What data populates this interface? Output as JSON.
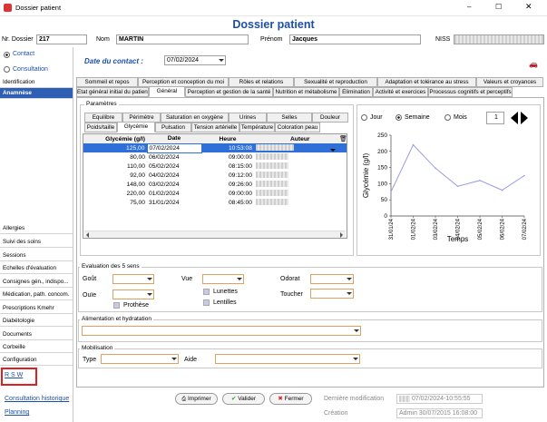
{
  "window": {
    "title": "Dossier patient"
  },
  "header": {
    "title": "Dossier patient",
    "nr_label": "Nr. Dossier",
    "nr_value": "217",
    "nom_label": "Nom",
    "nom_value": "MARTIN",
    "prenom_label": "Prénom",
    "prenom_value": "Jacques",
    "niss_label": "NISS"
  },
  "left": {
    "contact": "Contact",
    "consultation": "Consultation",
    "top_items": [
      "Identification",
      "Anamnèse"
    ],
    "items": [
      "Allergies",
      "Suivi des soins",
      "Sessions",
      "Echelles d'évaluation",
      "Consignes gén., indispo...",
      "Médication, path. concom.",
      "Prescriptions Kmehr",
      "Diabétologie",
      "Documents",
      "Corbeille",
      "Configuration"
    ],
    "rsw": "R S W",
    "consult_hist": "Consultation historique",
    "planning": "Planning"
  },
  "contact": {
    "date_label": "Date du contact :",
    "date_value": "07/02/2024"
  },
  "tabs": {
    "row1": [
      "Sommeil et repos",
      "Perception et conception du moi",
      "Rôles et relations",
      "Sexualité et reproduction",
      "Adaptation et tolérance au stress",
      "Valeurs et croyances"
    ],
    "row2": [
      "Etat général initial du patient",
      "Général",
      "Perception et gestion de la santé",
      "Nutrition et métabolisme",
      "Elimination",
      "Activité et exercices",
      "Processus cognitifs et perceptifs"
    ],
    "params_title": "Paramètres",
    "sub1": [
      "Equilibre",
      "Périmètre",
      "Saturation en oxygène",
      "Urines",
      "Selles",
      "Douleur"
    ],
    "sub2": [
      "Poids/taille",
      "Glycémie",
      "Pulsation",
      "Tension artérielle",
      "Température",
      "Coloration peau"
    ]
  },
  "table": {
    "headers": [
      "Glycémie (g/l)",
      "Date",
      "Heure",
      "Auteur"
    ],
    "rows": [
      [
        "125,00",
        "07/02/2024",
        "10:53:08"
      ],
      [
        "80,00",
        "06/02/2024",
        "09:00:00"
      ],
      [
        "110,00",
        "05/02/2024",
        "08:15:00"
      ],
      [
        "92,00",
        "04/02/2024",
        "09:12:00"
      ],
      [
        "148,00",
        "03/02/2024",
        "09:26:00"
      ],
      [
        "220,00",
        "01/02/2024",
        "09:00:00"
      ],
      [
        "75,00",
        "31/01/2024",
        "08:45:00"
      ]
    ]
  },
  "chart_ctrl": {
    "jour": "Jour",
    "semaine": "Semaine",
    "mois": "Mois",
    "count": "1"
  },
  "chart_data": {
    "type": "line",
    "x": [
      "31/01/24",
      "01/02/24",
      "03/02/24",
      "04/02/24",
      "05/02/24",
      "06/02/24",
      "07/02/24"
    ],
    "values": [
      75,
      220,
      148,
      92,
      110,
      80,
      125
    ],
    "ylabel": "Glycémie (g/l)",
    "xlabel": "Temps",
    "yticks": [
      "0",
      "50",
      "100",
      "150",
      "200",
      "250"
    ],
    "ylim": [
      0,
      250
    ],
    "color": "#9a9ae6"
  },
  "eval": {
    "title": "Evaluation des 5 sens",
    "gout": "Goût",
    "vue": "Vue",
    "odorat": "Odorat",
    "ouie": "Ouïe",
    "toucher": "Toucher",
    "lunettes": "Lunettes",
    "lentilles": "Lentilles",
    "prothese": "Prothèse"
  },
  "alim": {
    "title": "Alimentation et hydratation"
  },
  "mob": {
    "title": "Mobilisation",
    "type": "Type",
    "aide": "Aide"
  },
  "footer": {
    "imprimer": "Imprimer",
    "valider": "Valider",
    "fermer": "Fermer",
    "derniere_label": "Dernière modification",
    "derniere_value": "07/02/2024-10:55:55",
    "creation_label": "Création",
    "creation_value": "Admin 30/07/2015 16:08:00"
  }
}
